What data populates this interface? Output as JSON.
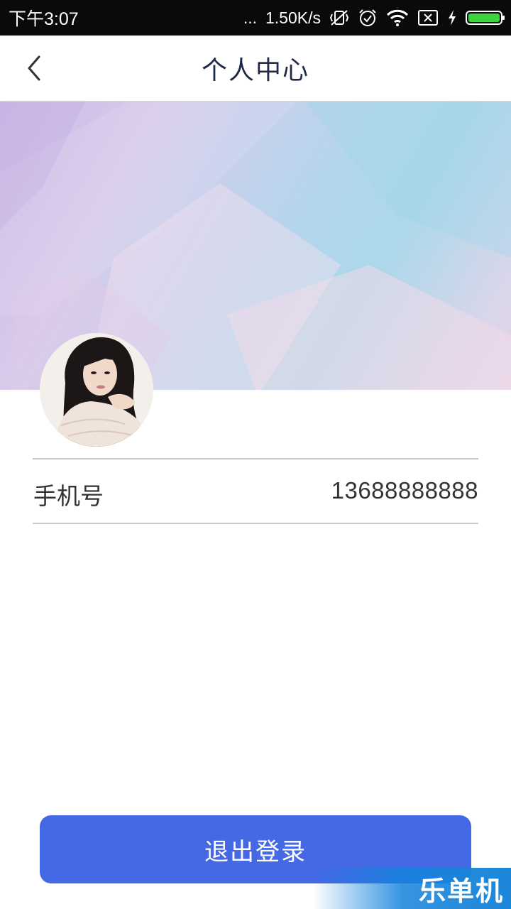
{
  "status_bar": {
    "time": "下午3:07",
    "dots": "...",
    "network_speed": "1.50K/s",
    "battery_level": 1.0
  },
  "header": {
    "title": "个人中心"
  },
  "profile": {
    "phone_label": "手机号",
    "phone_value": "13688888888"
  },
  "actions": {
    "logout_label": "退出登录"
  },
  "watermark": {
    "text": "乐单机"
  },
  "colors": {
    "primary_button": "#4568e4",
    "title_text": "#1f2a48",
    "battery_green": "#3fd23f"
  }
}
